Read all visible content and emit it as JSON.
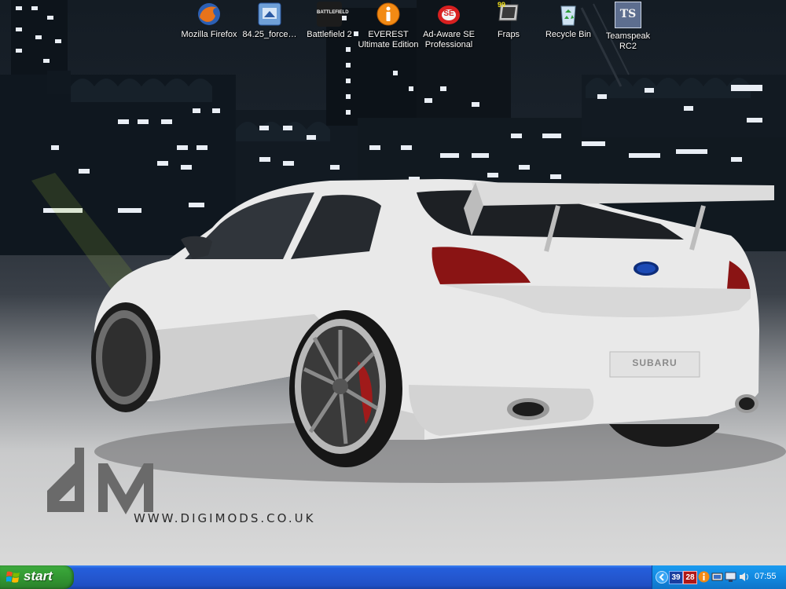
{
  "desktop": {
    "icons": [
      {
        "id": "firefox",
        "label": "Mozilla Firefox",
        "icon": "firefox-icon"
      },
      {
        "id": "force",
        "label": "84.25_force…",
        "icon": "installer-icon"
      },
      {
        "id": "bf2",
        "label": "Battlefield 2",
        "icon": "battlefield-icon",
        "logo_text": "BATTLEFIELD"
      },
      {
        "id": "everest",
        "label": "EVEREST Ultimate Edition",
        "icon": "info-icon"
      },
      {
        "id": "adaware",
        "label": "Ad-Aware SE Professional",
        "icon": "adaware-icon",
        "logo_text": "SE"
      },
      {
        "id": "fraps",
        "label": "Fraps",
        "icon": "fraps-icon",
        "logo_text": "99"
      },
      {
        "id": "recycle",
        "label": "Recycle Bin",
        "icon": "recycle-bin-icon"
      },
      {
        "id": "teamspeak",
        "label": "Teamspeak RC2",
        "icon": "teamspeak-icon",
        "logo_text": "TS"
      }
    ]
  },
  "wallpaper": {
    "car_badge": "SUBARU",
    "watermark_url": "WWW.DIGIMODS.CO.UK",
    "watermark_logo": "dM"
  },
  "taskbar": {
    "start_label": "start",
    "tray": {
      "temp1": "39",
      "temp2": "28",
      "clock": "07:55"
    }
  },
  "colors": {
    "taskbar_blue": "#245edb",
    "start_green": "#38a338",
    "tray_blue": "#1289e0"
  }
}
